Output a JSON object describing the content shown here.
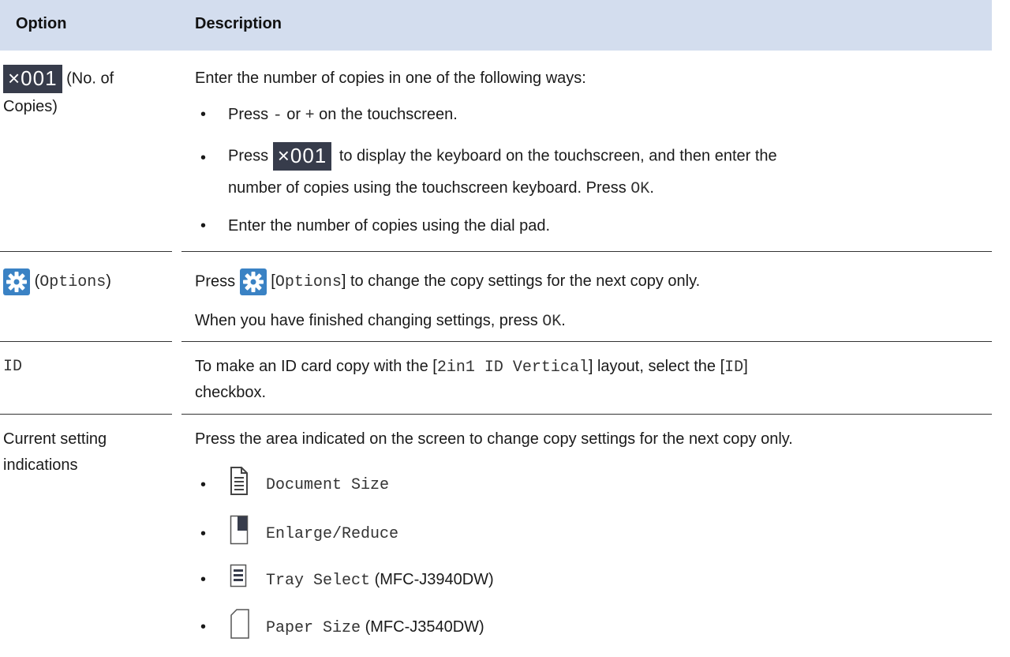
{
  "header": {
    "option": "Option",
    "description": "Description"
  },
  "rows": {
    "copies": {
      "badge": "×001",
      "label_a": "(No. of",
      "label_b": "Copies)",
      "intro": "Enter the number of copies in one of the following ways:",
      "b1_a": "Press ",
      "b1_minus": "-",
      "b1_mid": " or ",
      "b1_plus": "+",
      "b1_end": " on the touchscreen.",
      "b2_a": "Press ",
      "b2_badge": "×001",
      "b2_b": " to display the keyboard on the touchscreen, and then enter the",
      "b2_c": "number of copies using the touchscreen keyboard. Press ",
      "b2_ok": "OK",
      "b2_end": ".",
      "b3": "Enter the number of copies using the dial pad."
    },
    "options": {
      "label_open": "(",
      "label_mono": "Options",
      "label_close": ")",
      "p1_a": "Press ",
      "p1_b": " [",
      "p1_mono": "Options",
      "p1_c": "] to change the copy settings for the next copy only.",
      "p2_a": "When you have finished changing settings, press ",
      "p2_ok": "OK",
      "p2_end": "."
    },
    "id": {
      "label": "ID",
      "p1_a": "To make an ID card copy with the [",
      "p1_mono1": "2in1 ID Vertical",
      "p1_b": "] layout, select the [",
      "p1_mono2": "ID",
      "p1_c": "]",
      "p2": "checkbox."
    },
    "current": {
      "label_a": "Current setting",
      "label_b": "indications",
      "intro": "Press the area indicated on the screen to change copy settings for the next copy only.",
      "items": [
        {
          "mono": "Document Size",
          "note": "",
          "icon": "document-size-icon"
        },
        {
          "mono": "Enlarge/Reduce",
          "note": "",
          "icon": "enlarge-reduce-icon"
        },
        {
          "mono": "Tray Select",
          "note": " (MFC-J3940DW)",
          "icon": "tray-select-icon"
        },
        {
          "mono": "Paper Size",
          "note": " (MFC-J3540DW)",
          "icon": "paper-size-icon"
        }
      ]
    }
  },
  "bullet": "•",
  "colors": {
    "header_bg": "#d3ddee",
    "badge_bg": "#373c4b",
    "gear_bg": "#3a82c4"
  }
}
